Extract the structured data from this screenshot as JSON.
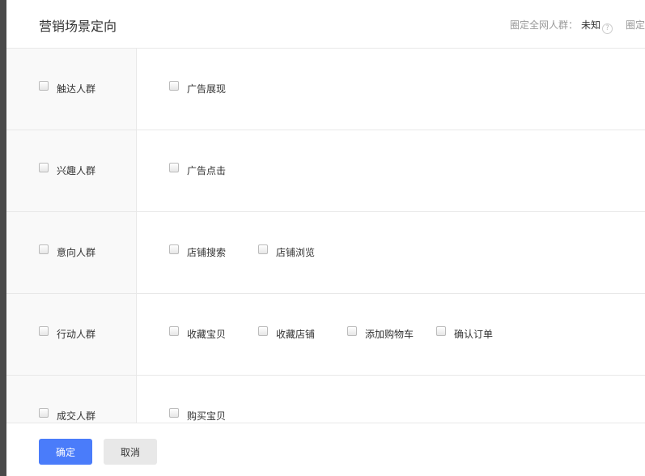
{
  "header": {
    "title": "营销场景定向",
    "audience_label": "圈定全网人群：",
    "audience_value": "未知",
    "help": "?",
    "more": "圈定"
  },
  "rows": [
    {
      "label": "触达人群",
      "items": [
        "广告展现"
      ]
    },
    {
      "label": "兴趣人群",
      "items": [
        "广告点击"
      ]
    },
    {
      "label": "意向人群",
      "items": [
        "店铺搜索",
        "店铺浏览"
      ]
    },
    {
      "label": "行动人群",
      "items": [
        "收藏宝贝",
        "收藏店铺",
        "添加购物车",
        "确认订单"
      ]
    },
    {
      "label": "成交人群",
      "items": [
        "购买宝贝"
      ]
    }
  ],
  "footer": {
    "confirm": "确定",
    "cancel": "取消"
  }
}
